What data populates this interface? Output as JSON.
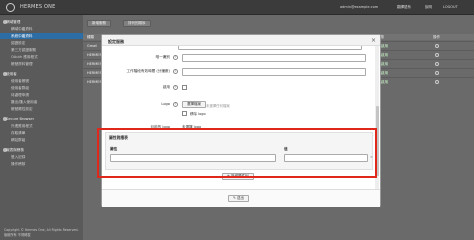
{
  "header": {
    "brand": "HERMES ONE",
    "user_email": "admin@example.com",
    "links": [
      "翻譯語系",
      "說明",
      "LOGOUT"
    ]
  },
  "sidebar": {
    "items": [
      {
        "label": "網域管理",
        "icon": "globe-icon"
      },
      {
        "label": "網域中繼資料",
        "sub": true
      },
      {
        "label": "系統中繼資料",
        "sub": true,
        "active": true
      },
      {
        "label": "認證設定",
        "sub": true
      },
      {
        "label": "第三方認證服務",
        "sub": true
      },
      {
        "label": "OAuth 應用程式",
        "sub": true
      },
      {
        "label": "帳號資料管理",
        "sub": true
      },
      {
        "label": "使用者",
        "icon": "user-icon"
      },
      {
        "label": "使用者帳號",
        "sub": true
      },
      {
        "label": "使用者群組",
        "sub": true
      },
      {
        "label": "待處理申請",
        "sub": true
      },
      {
        "label": "匯出/匯入使用者",
        "sub": true
      },
      {
        "label": "帳號屬性設定",
        "sub": true
      },
      {
        "label": "Secure Browser",
        "icon": "browser-icon"
      },
      {
        "label": "外連應用程式",
        "sub": true
      },
      {
        "label": "存取清單",
        "sub": true
      },
      {
        "label": "網站群組",
        "sub": true
      },
      {
        "label": "報表與稽核",
        "icon": "chart-icon"
      },
      {
        "label": "登入記錄",
        "sub": true
      },
      {
        "label": "操作稽核",
        "sub": true
      }
    ],
    "footer": "Copyright © Hermes One, All Rights Reserved. 版權所有 不得轉載"
  },
  "toolbar": {
    "add_label": "新增服務",
    "sort_label": "排列的順序"
  },
  "table": {
    "headers": [
      "種類",
      "狀態",
      "操作"
    ],
    "rows": [
      {
        "type": "Gmail",
        "status": "啟用"
      },
      {
        "type": "HERMES",
        "status": "啟用"
      },
      {
        "type": "HERMES",
        "status": "啟用"
      },
      {
        "type": "HERMES",
        "status": "啟用"
      },
      {
        "type": "HERMES",
        "status": "啟用"
      }
    ]
  },
  "modal": {
    "title": "設定服務",
    "fields": {
      "unique_id_label": "唯一識別",
      "timeout_label": "工作階段有效時間 (分鐘數)",
      "enabled_label": "啟用",
      "logo_label": "Logo",
      "logo_button": "選擇檔案",
      "logo_status": "未選擇任何檔案",
      "remove_logo_label": "移除 logo",
      "current_logo_label": "目前的 logo",
      "current_logo_value": "未選擇 logo"
    },
    "attr_mapping": {
      "title": "屬性對應表",
      "col_attr": "屬性",
      "col_value": "值",
      "add_button": "新增屬性列"
    },
    "submit_label": "送出"
  }
}
